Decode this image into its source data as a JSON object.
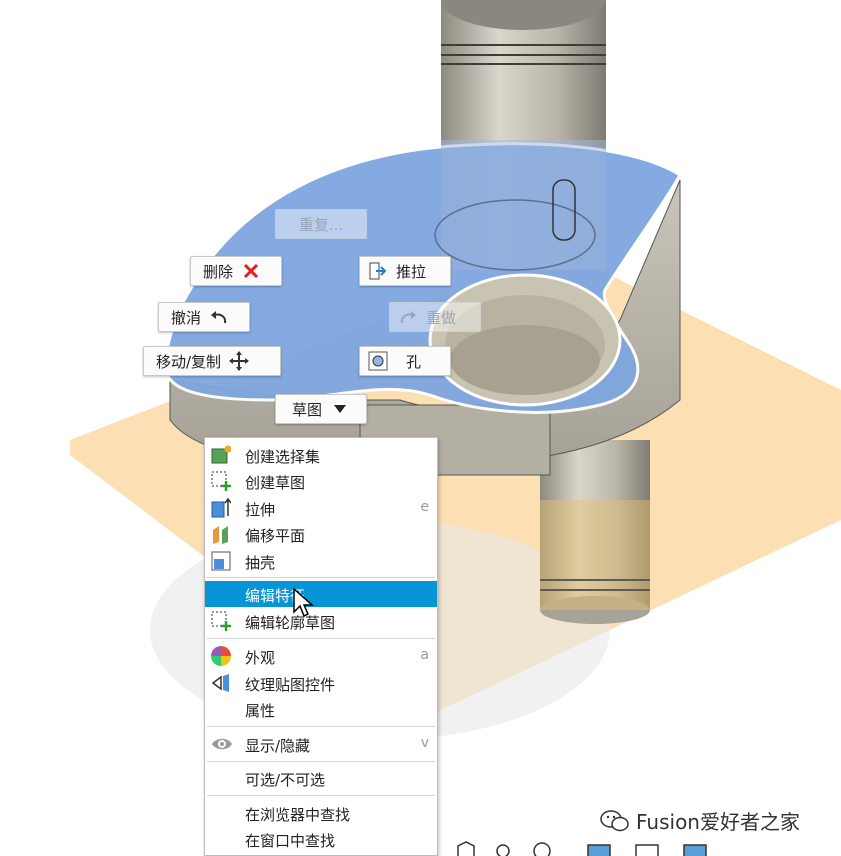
{
  "marking_menu": {
    "repeat": "重复...",
    "delete": "删除",
    "press_pull": "推拉",
    "undo": "撤消",
    "redo": "重做",
    "move_copy": "移动/复制",
    "hole": "孔",
    "sketch": "草图"
  },
  "context_menu": {
    "items": [
      {
        "label": "创建选择集",
        "shortcut": ""
      },
      {
        "label": "创建草图",
        "shortcut": ""
      },
      {
        "label": "拉伸",
        "shortcut": "e"
      },
      {
        "label": "偏移平面",
        "shortcut": ""
      },
      {
        "label": "抽壳",
        "shortcut": ""
      },
      {
        "label": "编辑特征",
        "shortcut": ""
      },
      {
        "label": "编辑轮廓草图",
        "shortcut": ""
      },
      {
        "label": "外观",
        "shortcut": "a"
      },
      {
        "label": "纹理贴图控件",
        "shortcut": ""
      },
      {
        "label": "属性",
        "shortcut": ""
      },
      {
        "label": "显示/隐藏",
        "shortcut": "v"
      },
      {
        "label": "可选/不可选",
        "shortcut": ""
      },
      {
        "label": "在浏览器中查找",
        "shortcut": ""
      },
      {
        "label": "在窗口中查找",
        "shortcut": ""
      }
    ]
  },
  "watermark": "Fusion爱好者之家",
  "colors": {
    "highlight": "#0696d7",
    "selected_face": "#7ea6e0",
    "sketch_plane": "#fbd49a",
    "delete_red": "#e0201b"
  }
}
